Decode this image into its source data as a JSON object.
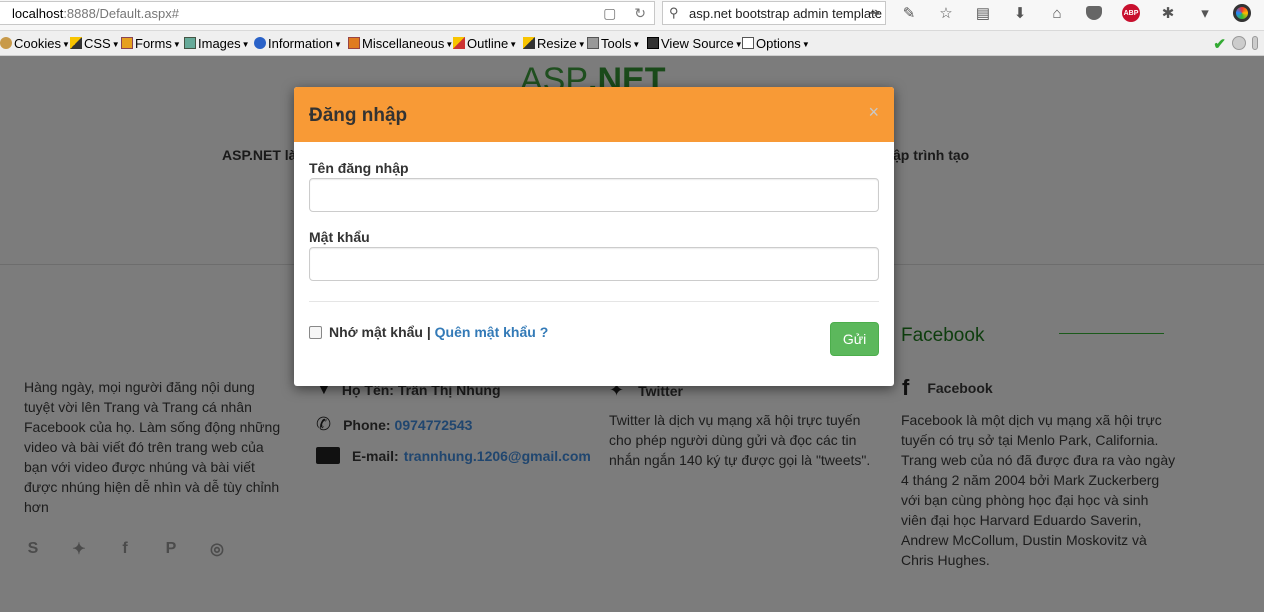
{
  "browser": {
    "url_host": "localhost",
    "url_path": ":8888/Default.aspx#",
    "search_text": "asp.net bootstrap admin template",
    "toolbar_icons": [
      "rss-icon",
      "star-icon",
      "reader-icon",
      "download-icon",
      "home-icon",
      "pocket-icon",
      "adblock-icon",
      "bug-icon",
      "menu-icon",
      "chrome-icon"
    ]
  },
  "devbar": {
    "items": [
      "Cookies",
      "CSS",
      "Forms",
      "Images",
      "Information",
      "Miscellaneous",
      "Outline",
      "Resize",
      "Tools",
      "View Source",
      "Options"
    ]
  },
  "page": {
    "logo_light": "ASP",
    "logo_bold": ".NET",
    "hero_left": "ASP.NET là",
    "hero_right": "ập trình tạo",
    "about_text": "Hàng ngày, mọi người đăng nội dung tuyệt vời lên Trang và Trang cá nhân Facebook của họ. Làm sống động những video và bài viết đó trên trang web của bạn với video được nhúng và bài viết được nhúng hiện dễ nhìn và dễ tùy chỉnh hơn",
    "contact_name_label": "Họ Tên: Trần Thị Nhung",
    "phone_label": "Phone:",
    "phone_value": "0974772543",
    "email_label": "E-mail:",
    "email_value": "trannhung.1206@gmail.com",
    "twitter_heading": "Twitter",
    "twitter_text": "Twitter là dịch vụ mạng xã hội trực tuyến cho phép người dùng gửi và đọc các tin nhắn ngắn 140 ký tự được gọi là \"tweets\".",
    "facebook_title": "Facebook",
    "facebook_heading": "Facebook",
    "facebook_text": "Facebook là một dịch vụ mạng xã hội trực tuyến có trụ sở tại Menlo Park, California. Trang web của nó đã được đưa ra vào ngày 4 tháng 2 năm 2004 bởi Mark Zuckerberg với bạn cùng phòng học đại học và sinh viên đại học Harvard Eduardo Saverin, Andrew McCollum, Dustin Moskovitz và Chris Hughes."
  },
  "modal": {
    "title": "Đăng nhập",
    "close": "×",
    "username_label": "Tên đăng nhập",
    "username_value": "",
    "password_label": "Mật khẩu",
    "password_value": "",
    "remember_label": "Nhớ mật khẩu",
    "separator": "|",
    "forgot_label": "Quên mật khẩu ?",
    "submit_label": "Gửi"
  },
  "colors": {
    "modal_header": "#f89a36",
    "submit_button": "#5cb85c",
    "link": "#337ab7",
    "overlay": "#7c7c7c"
  }
}
